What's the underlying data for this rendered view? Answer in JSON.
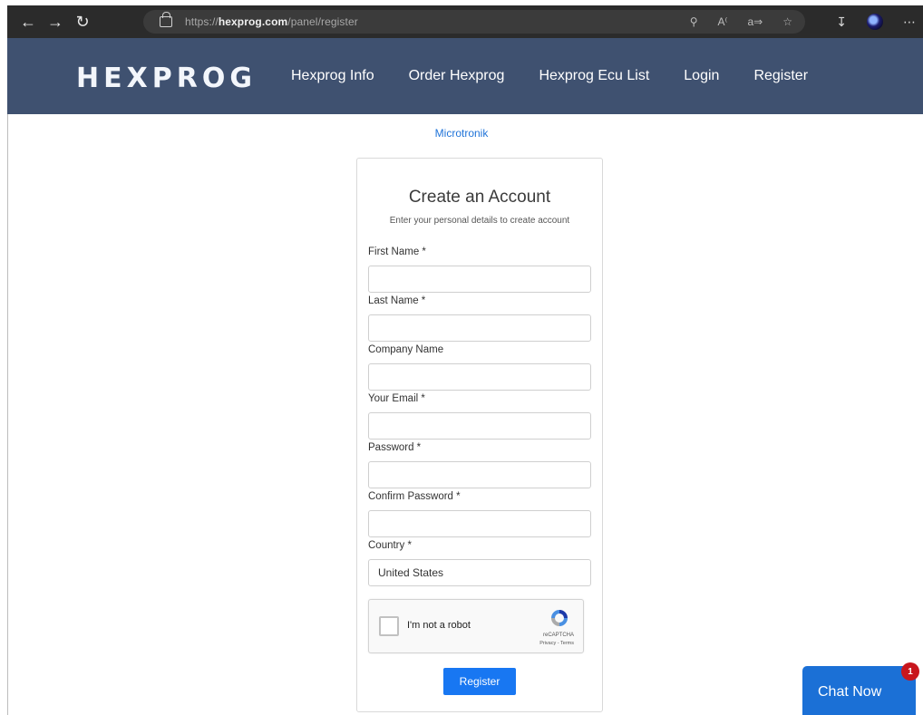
{
  "browser": {
    "url_prefix": "https://",
    "url_domain": "hexprog.com",
    "url_path": "/panel/register"
  },
  "header": {
    "logo": "HEXPROG",
    "nav": [
      "Hexprog Info",
      "Order Hexprog",
      "Hexprog Ecu List",
      "Login",
      "Register"
    ]
  },
  "brand_link": "Microtronik",
  "form": {
    "title": "Create an Account",
    "subtitle": "Enter your personal details to create account",
    "fields": [
      {
        "label": "First Name *",
        "value": ""
      },
      {
        "label": "Last Name *",
        "value": ""
      },
      {
        "label": "Company Name",
        "value": ""
      },
      {
        "label": "Your Email *",
        "value": ""
      },
      {
        "label": "Password *",
        "value": ""
      },
      {
        "label": "Confirm Password *",
        "value": ""
      },
      {
        "label": "Country *",
        "value": "United States"
      }
    ],
    "captcha": {
      "label": "I'm not a robot",
      "brand": "reCAPTCHA",
      "terms": "Privacy - Terms"
    },
    "submit_label": "Register"
  },
  "chat": {
    "label": "Chat Now",
    "badge": "1"
  },
  "colors": {
    "header_bg": "#3f5170",
    "accent": "#1877f2",
    "chat_bg": "#1b70d6",
    "badge": "#c8161d"
  },
  "icons": [
    "back-icon",
    "forward-icon",
    "refresh-icon",
    "lock-icon",
    "key-icon",
    "read-aloud-icon",
    "translate-icon",
    "favorites-icon",
    "download-icon",
    "profile-icon",
    "menu-icon",
    "recaptcha-logo-icon"
  ]
}
